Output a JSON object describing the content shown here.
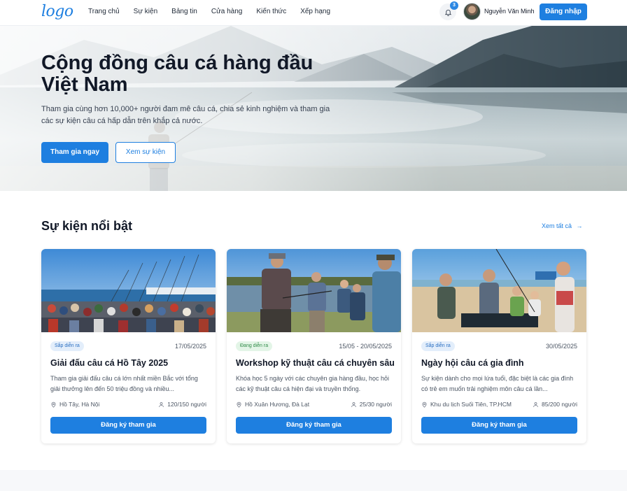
{
  "nav": {
    "logo": "logo",
    "menu": [
      "Trang chủ",
      "Sự kiện",
      "Bảng tin",
      "Cửa hàng",
      "Kiến thức",
      "Xếp hạng"
    ],
    "notification_count": "3",
    "user_name": "Nguyễn Văn Minh",
    "login_label": "Đăng nhập"
  },
  "hero": {
    "title": "Cộng đồng câu cá hàng đầu Việt Nam",
    "subtitle": "Tham gia cùng hơn 10,000+ người đam mê câu cá, chia sẻ kinh nghiệm và tham gia các sự kiện câu cá hấp dẫn trên khắp cả nước.",
    "primary_button": "Tham gia ngay",
    "secondary_button": "Xem sự kiện"
  },
  "featured": {
    "title": "Sự kiện nổi bật",
    "see_all": "Xem tất cả",
    "cards": [
      {
        "badge": "Sắp diễn ra",
        "date": "17/05/2025",
        "title": "Giải đấu câu cá Hồ Tây 2025",
        "description": "Tham gia giải đấu câu cá lớn nhất miền Bắc với tổng giải thưởng lên đến 50 triệu đồng và nhiều...",
        "location": "Hồ Tây, Hà Nội",
        "participants": "120/150 người",
        "button": "Đăng ký tham gia"
      },
      {
        "badge": "Đang diễn ra",
        "date": "15/05 - 20/05/2025",
        "title": "Workshop kỹ thuật câu cá chuyên sâu",
        "description": "Khóa học 5 ngày với các chuyên gia hàng đầu, học hỏi các kỹ thuật câu cá hiện đại và truyền thống.",
        "location": "Hồ Xuân Hương, Đà Lạt",
        "participants": "25/30 người",
        "button": "Đăng ký tham gia"
      },
      {
        "badge": "Sắp diễn ra",
        "date": "30/05/2025",
        "title": "Ngày hội câu cá gia đình",
        "description": "Sự kiện dành cho mọi lứa tuổi, đặc biệt là các gia đình có trẻ em muốn trải nghiệm môn câu cá lần...",
        "location": "Khu du lịch Suối Tiên, TP.HCM",
        "participants": "85/200 người",
        "button": "Đăng ký tham gia"
      }
    ]
  },
  "colors": {
    "accent": "#1e7fe0"
  }
}
